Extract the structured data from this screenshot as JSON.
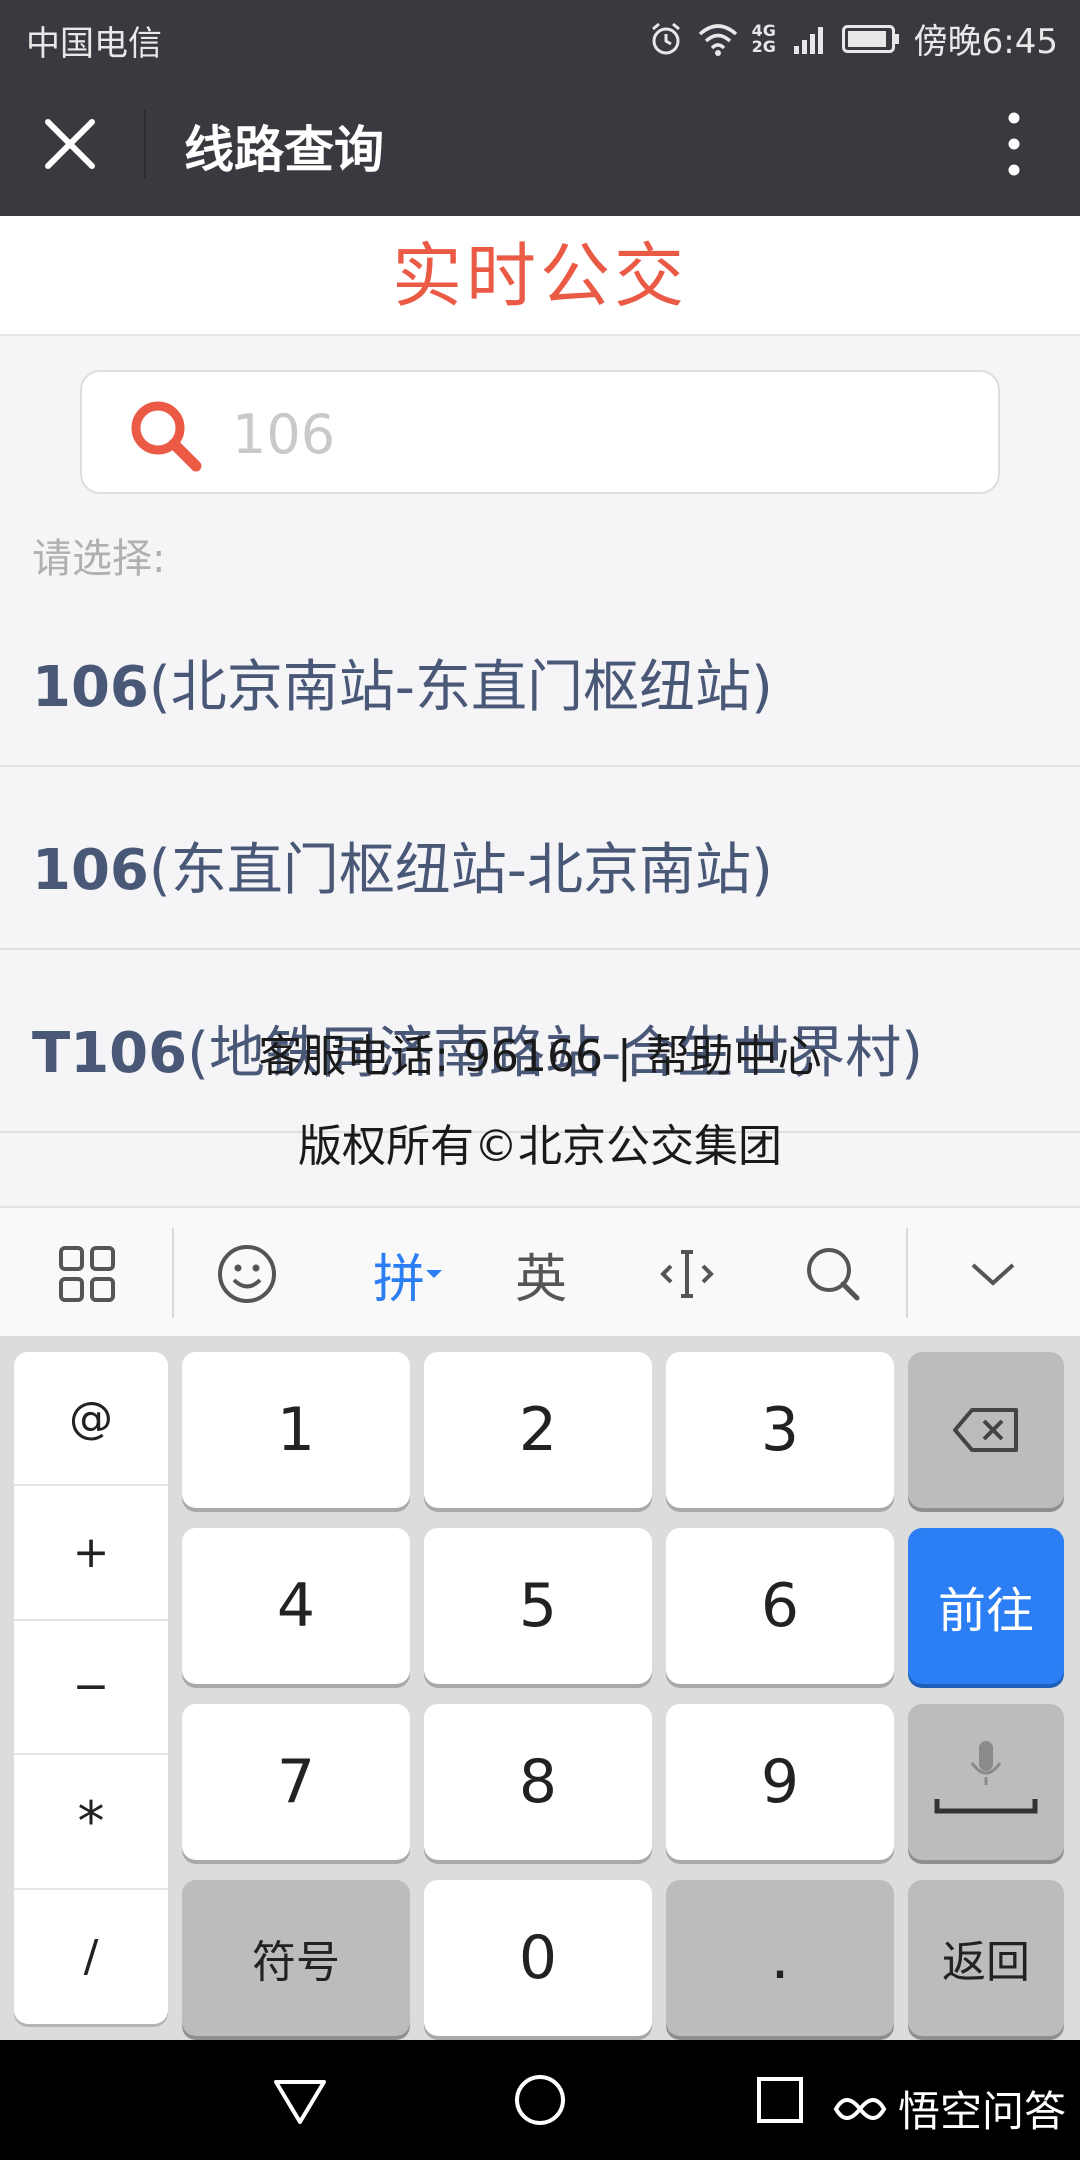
{
  "status_bar": {
    "carrier": "中国电信",
    "network": "4G 2G",
    "time": "傍晚6:45"
  },
  "app_bar": {
    "title": "线路查询"
  },
  "page": {
    "title": "实时公交",
    "search": {
      "value": "",
      "placeholder": "106"
    },
    "choose_label": "请选择:",
    "routes": [
      {
        "number": "106",
        "stops": "(北京南站-东直门枢纽站)"
      },
      {
        "number": "106",
        "stops": "(东直门枢纽站-北京南站)"
      },
      {
        "number": "T106",
        "stops": "(地铁同济南路站-合生世界村)"
      }
    ],
    "footer": {
      "service_phone": "客服电话: 96166 | 帮助中心",
      "copyright": "版权所有©北京公交集团"
    }
  },
  "keyboard": {
    "toolbar": {
      "pinyin": "拼",
      "english": "英"
    },
    "symbols": [
      "@",
      "+",
      "−",
      "*",
      "/"
    ],
    "keys": {
      "k1": "1",
      "k2": "2",
      "k3": "3",
      "k4": "4",
      "k5": "5",
      "k6": "6",
      "k7": "7",
      "k8": "8",
      "k9": "9",
      "k0": "0",
      "dot": ".",
      "symbol": "符号",
      "go": "前往",
      "back": "返回"
    }
  },
  "watermark": "悟空问答",
  "colors": {
    "header_bg": "#393a3f",
    "accent_red": "#ea5a45",
    "route_text": "#4a5878",
    "go_key": "#2c7ef4",
    "toolbar_active": "#2c7ef4"
  }
}
